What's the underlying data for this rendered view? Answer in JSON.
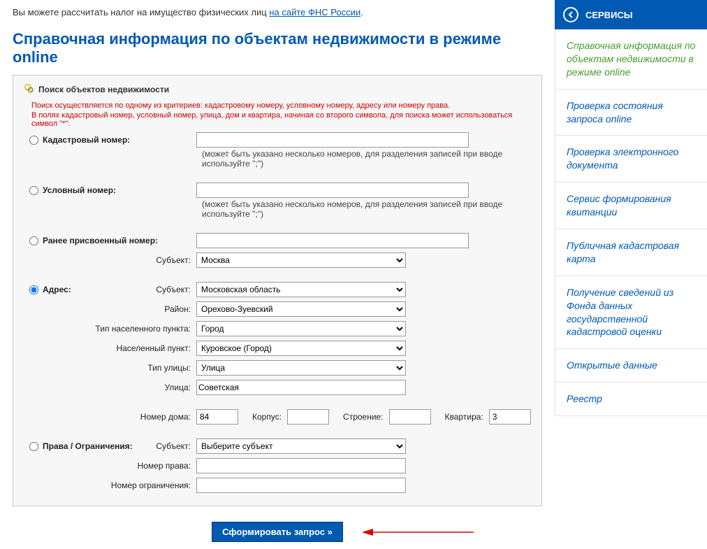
{
  "intro": {
    "text_prefix": "Вы можете рассчитать налог на имущество физических лиц ",
    "link_text": "на сайте ФНС России",
    "text_suffix": "."
  },
  "page_title": "Справочная информация по объектам недвижимости в режиме online",
  "panel": {
    "header": "Поиск объектов недвижимости",
    "hint1": "Поиск осуществляется по одному из критериев: кадастровому номеру, условному номеру, адресу или номеру права.",
    "hint2": "В полях кадастровый номер, условный номер, улица, дом и квартира, начиная со второго символа, для поиска может использоваться символ \"*\"."
  },
  "labels": {
    "cadastral": "Кадастровый номер:",
    "cadastral_help": "(может быть указано несколько номеров, для разделения записей при вводе используйте \";\")",
    "conditional": "Условный номер:",
    "conditional_help": "(может быть указано несколько номеров, для разделения записей при вводе используйте \";\")",
    "previous": "Ранее присвоенный номер:",
    "subject": "Субъект:",
    "address": "Адрес:",
    "district": "Район:",
    "settlement_type": "Тип населенного пункта:",
    "settlement": "Населенный пункт:",
    "street_type": "Тип улицы:",
    "street": "Улица:",
    "house_no": "Номер дома:",
    "korpus": "Корпус:",
    "building": "Строение:",
    "apartment": "Квартира:",
    "rights": "Права / Ограничения:",
    "right_no": "Номер права:",
    "limitation_no": "Номер ограничения:"
  },
  "values": {
    "prev_subject": "Москва",
    "addr_subject": "Московская область",
    "addr_district": "Орехово-Зуевский",
    "addr_settlement_type": "Город",
    "addr_settlement": "Куровское (Город)",
    "addr_street_type": "Улица",
    "addr_street": "Советская",
    "addr_house": "84",
    "addr_korpus": "",
    "addr_building": "",
    "addr_apartment": "3",
    "rights_subject": "Выберите субъект",
    "right_no": "",
    "limitation_no": ""
  },
  "submit": "Сформировать запрос »",
  "sidebar": {
    "header": "СЕРВИСЫ",
    "items": [
      "Справочная информация по объектам недвижимости в режиме online",
      "Проверка состояния запроса online",
      "Проверка электронного документа",
      "Сервис формирования квитанции",
      "Публичная кадастровая карта",
      "Получение сведений из Фонда данных государственной кадастровой оценки",
      "Открытые данные",
      "Реестр"
    ]
  }
}
